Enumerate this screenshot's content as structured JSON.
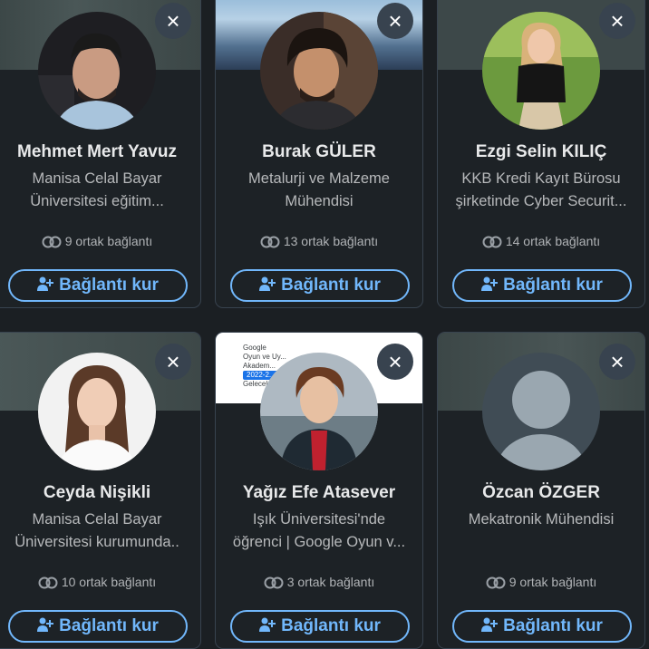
{
  "suggestions": [
    {
      "name": "Mehmet Mert Yavuz",
      "description": "Manisa Celal Bayar Üniversitesi eğitim...",
      "mutual": "9 ortak bağlantı",
      "button": "Bağlantı kur"
    },
    {
      "name": "Burak GÜLER",
      "description": "Metalurji ve Malzeme Mühendisi",
      "mutual": "13 ortak bağlantı",
      "button": "Bağlantı kur"
    },
    {
      "name": "Ezgi Selin KILIÇ",
      "description": "KKB Kredi Kayıt Bürosu şirketinde Cyber Securit...",
      "mutual": "14 ortak bağlantı",
      "button": "Bağlantı kur"
    },
    {
      "name": "Ceyda Nişikli",
      "description": "Manisa Celal Bayar Üniversitesi kurumunda..",
      "mutual": "10 ortak bağlantı",
      "button": "Bağlantı kur"
    },
    {
      "name": "Yağız Efe Atasever",
      "description": "Işık Üniversitesi'nde öğrenci | Google Oyun v...",
      "mutual": "3 ortak bağlantı",
      "button": "Bağlantı kur"
    },
    {
      "name": "Özcan ÖZGER",
      "description": "Mekatronik Mühendisi",
      "mutual": "9 ortak bağlantı",
      "button": "Bağlantı kur"
    }
  ],
  "banner_text": {
    "brand": "Google",
    "line1": "Oyun ve Uy...",
    "line2": "Akadem...",
    "year": "2022-2...",
    "foot": "Gelecek..."
  },
  "icons": {
    "close": "×",
    "dismiss": "close-icon",
    "mutual": "mutual-connections-icon",
    "connect": "add-person-icon"
  },
  "colors": {
    "accent": "#71b7fb",
    "card": "#1d2226",
    "text": "#e8e9ea"
  }
}
